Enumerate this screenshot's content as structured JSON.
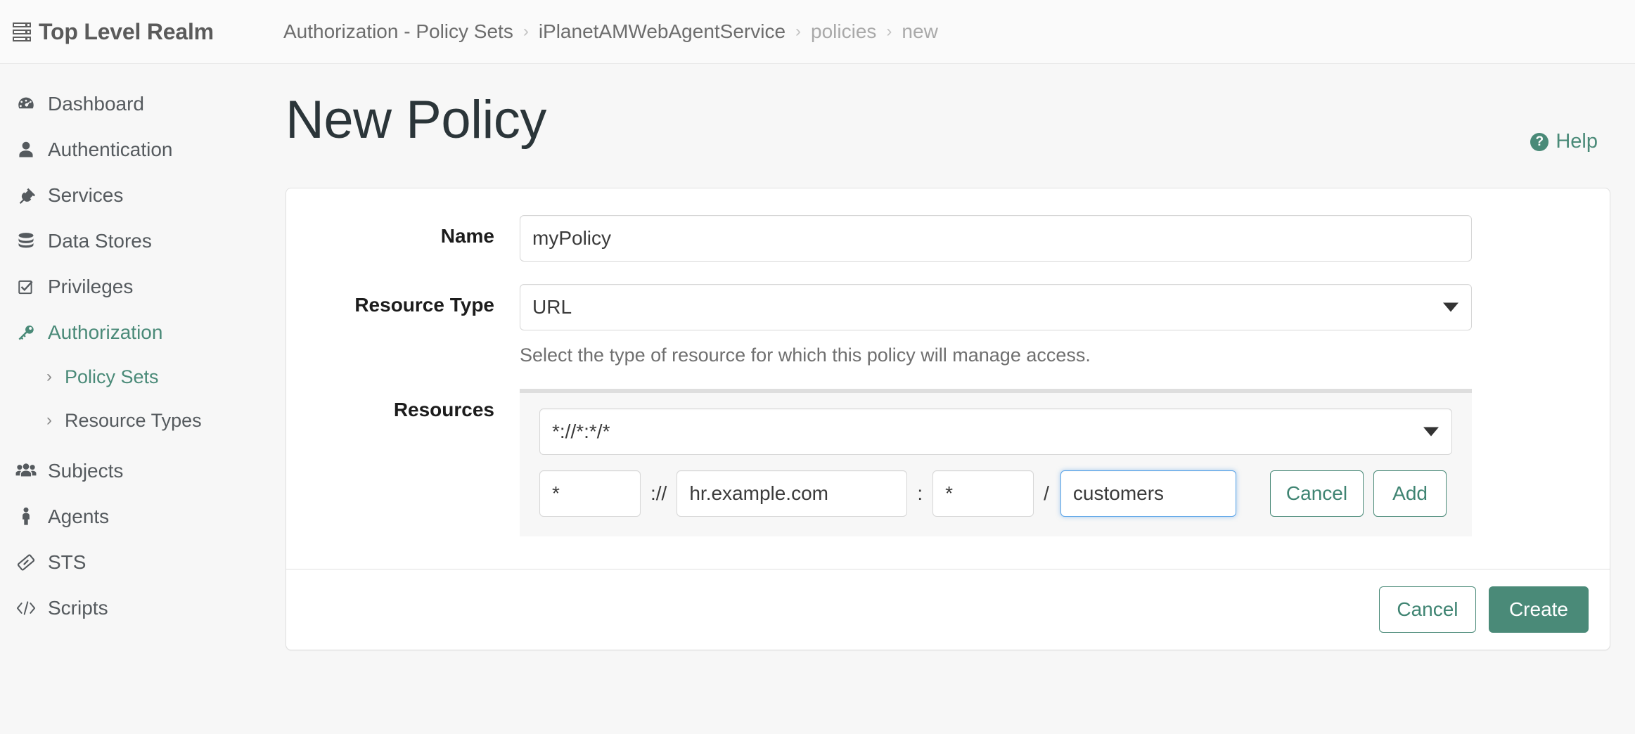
{
  "topbar": {
    "realm_icon": "server-stack-icon",
    "realm_label": "Top Level Realm",
    "breadcrumb": [
      {
        "label": "Authorization - Policy Sets",
        "muted": false
      },
      {
        "label": "iPlanetAMWebAgentService",
        "muted": false
      },
      {
        "label": "policies",
        "muted": true
      },
      {
        "label": "new",
        "muted": true
      }
    ],
    "separator": "›"
  },
  "sidebar": {
    "items": [
      {
        "label": "Dashboard",
        "icon": "dashboard-gauge-icon",
        "active": false
      },
      {
        "label": "Authentication",
        "icon": "user-icon",
        "active": false
      },
      {
        "label": "Services",
        "icon": "plug-icon",
        "active": false
      },
      {
        "label": "Data Stores",
        "icon": "database-icon",
        "active": false
      },
      {
        "label": "Privileges",
        "icon": "checkbox-icon",
        "active": false
      },
      {
        "label": "Authorization",
        "icon": "key-icon",
        "active": true
      }
    ],
    "subitems": [
      {
        "label": "Policy Sets",
        "icon": "chevron-right-icon",
        "active": true
      },
      {
        "label": "Resource Types",
        "icon": "chevron-right-icon",
        "active": false
      }
    ],
    "items_bottom": [
      {
        "label": "Subjects",
        "icon": "users-group-icon",
        "active": false
      },
      {
        "label": "Agents",
        "icon": "person-icon",
        "active": false
      },
      {
        "label": "STS",
        "icon": "ticket-icon",
        "active": false
      },
      {
        "label": "Scripts",
        "icon": "code-brackets-icon",
        "active": false
      }
    ]
  },
  "page": {
    "title": "New Policy",
    "help_label": "Help",
    "help_icon": "question-circle-icon"
  },
  "form": {
    "name": {
      "label": "Name",
      "value": "myPolicy",
      "placeholder": "Name"
    },
    "resource_type": {
      "label": "Resource Type",
      "value": "URL",
      "help": "Select the type of resource for which this policy will manage access.",
      "caret_icon": "chevron-down-icon"
    },
    "resources": {
      "label": "Resources",
      "pattern_value": "*://*:*/*",
      "caret_icon": "chevron-down-icon",
      "scheme": "*",
      "scheme_sep": "://",
      "host": "hr.example.com",
      "host_sep": ":",
      "port": "*",
      "port_sep": "/",
      "path": "customers",
      "cancel_label": "Cancel",
      "add_label": "Add"
    }
  },
  "footer": {
    "cancel_label": "Cancel",
    "create_label": "Create"
  },
  "colors": {
    "accent": "#4a8a78",
    "focus_blue": "#5ba4e8",
    "text_dark": "#2b3539",
    "muted": "#a9a9a9"
  }
}
